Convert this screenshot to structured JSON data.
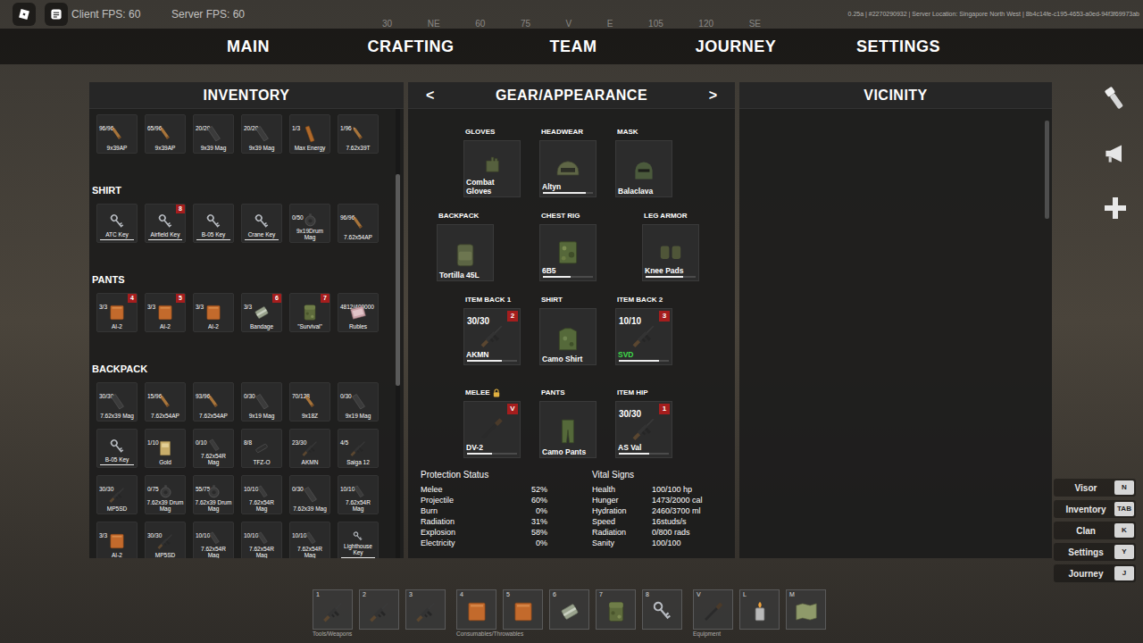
{
  "hud": {
    "client_fps": "Client FPS: 60",
    "server_fps": "Server FPS: 60",
    "server_info": "0.25a | #2270290932 | Server Location: Singapore North West | 8b4c14fe-c195-4653-a0ed-94f3f69973ab"
  },
  "compass": [
    "30",
    "NE",
    "60",
    "75",
    "V",
    "E",
    "105",
    "120",
    "SE"
  ],
  "nav": [
    "MAIN",
    "CRAFTING",
    "TEAM",
    "JOURNEY",
    "SETTINGS"
  ],
  "inventory": {
    "title": "INVENTORY",
    "sections": [
      {
        "items": [
          {
            "count": "96/96",
            "name": "9x39AP",
            "kind": "ammo"
          },
          {
            "count": "65/96",
            "name": "9x39AP",
            "kind": "ammo"
          },
          {
            "count": "20/20",
            "name": "9x39 Mag",
            "kind": "mag"
          },
          {
            "count": "20/20",
            "name": "9x39 Mag",
            "kind": "mag"
          },
          {
            "count": "1/3",
            "name": "Max Energy",
            "kind": "energy"
          },
          {
            "count": "1/96",
            "name": "7.62x39T",
            "kind": "ammo"
          }
        ]
      },
      {
        "label": "SHIRT",
        "items": [
          {
            "name": "ATC Key",
            "kind": "key",
            "level": 1
          },
          {
            "name": "Airfield Key",
            "kind": "key",
            "badge": "8",
            "level": 1
          },
          {
            "name": "B-05 Key",
            "kind": "key",
            "level": 1
          },
          {
            "name": "Crane Key",
            "kind": "key",
            "level": 1
          },
          {
            "count": "0/50",
            "name": "9x19Drum Mag",
            "kind": "drum"
          },
          {
            "count": "96/96",
            "name": "7.62x54AP",
            "kind": "ammo"
          }
        ]
      },
      {
        "label": "PANTS",
        "items": [
          {
            "count": "3/3",
            "name": "AI-2",
            "kind": "medkit",
            "badge": "4"
          },
          {
            "count": "3/3",
            "name": "AI-2",
            "kind": "medkit",
            "badge": "5"
          },
          {
            "count": "3/3",
            "name": "AI-2",
            "kind": "medkit"
          },
          {
            "count": "3/3",
            "name": "Bandage",
            "kind": "bandage",
            "badge": "6"
          },
          {
            "name": "\"Survival\"",
            "kind": "pouch",
            "badge": "7"
          },
          {
            "count": "4812/400000",
            "name": "Rubles",
            "kind": "money"
          }
        ]
      },
      {
        "label": "BACKPACK",
        "items": [
          {
            "count": "30/30",
            "name": "7.62x39 Mag",
            "kind": "mag"
          },
          {
            "count": "15/96",
            "name": "7.62x54AP",
            "kind": "ammo"
          },
          {
            "count": "93/96",
            "name": "7.62x54AP",
            "kind": "ammo"
          },
          {
            "count": "0/30",
            "name": "9x19 Mag",
            "kind": "mag"
          },
          {
            "count": "70/128",
            "name": "9x18Z",
            "kind": "ammo"
          },
          {
            "count": "0/30",
            "name": "9x19 Mag",
            "kind": "mag"
          },
          {
            "name": "B-05 Key",
            "kind": "key",
            "level": 1
          },
          {
            "count": "1/10",
            "name": "Gold",
            "kind": "gold"
          },
          {
            "count": "0/10",
            "name": "7.62x54R Mag",
            "kind": "mag"
          },
          {
            "count": "8/8",
            "name": "TFZ-O",
            "kind": "optic"
          },
          {
            "count": "23/30",
            "name": "AKMN",
            "kind": "weapon"
          },
          {
            "count": "4/5",
            "name": "Saiga 12",
            "kind": "weapon"
          },
          {
            "count": "30/30",
            "name": "MP5SD",
            "kind": "weapon"
          },
          {
            "count": "0/75",
            "name": "7.62x39 Drum Mag",
            "kind": "drum"
          },
          {
            "count": "55/75",
            "name": "7.62x39 Drum Mag",
            "kind": "drum"
          },
          {
            "count": "10/10",
            "name": "7.62x54R Mag",
            "kind": "mag"
          },
          {
            "count": "0/30",
            "name": "7.62x39 Mag",
            "kind": "mag"
          },
          {
            "count": "10/10",
            "name": "7.62x54R Mag",
            "kind": "mag"
          },
          {
            "count": "3/3",
            "name": "AI-2",
            "kind": "medkit"
          },
          {
            "count": "30/30",
            "name": "MP5SD",
            "kind": "weapon"
          },
          {
            "count": "10/10",
            "name": "7.62x54R Mag",
            "kind": "mag"
          },
          {
            "count": "10/10",
            "name": "7.62x54R Mag",
            "kind": "mag"
          },
          {
            "count": "10/10",
            "name": "7.62x54R Mag",
            "kind": "mag"
          },
          {
            "name": "Lighthouse Key",
            "kind": "key",
            "level": 1
          }
        ]
      }
    ]
  },
  "gear": {
    "title": "GEAR/APPEARANCE",
    "prev": "<",
    "next": ">",
    "rows": [
      [
        {
          "label": "GLOVES",
          "name": "Combat Gloves",
          "kind": "gloves",
          "color": "#ffffff",
          "locked": false
        },
        {
          "label": "HEADWEAR",
          "name": "Altyn",
          "kind": "helmet",
          "color": "#ffffff",
          "locked": false,
          "level": 0.85
        },
        {
          "label": "MASK",
          "name": "Balaclava",
          "kind": "mask",
          "color": "#ffffff",
          "locked": false
        }
      ],
      [
        {
          "label": "BACKPACK",
          "name": "Tortilla 45L",
          "kind": "backpack",
          "color": "#ffffff",
          "locked": false
        },
        {
          "label": "CHEST RIG",
          "name": "6B5",
          "kind": "rig",
          "color": "#ffffff",
          "locked": false,
          "level": 0.55
        },
        {
          "label": "LEG ARMOR",
          "name": "Knee Pads",
          "kind": "kneepad",
          "color": "#ffffff",
          "locked": false,
          "level": 0.75
        }
      ],
      [
        {
          "label": "ITEM BACK 1",
          "count": "30/30",
          "badge": "2",
          "name": "AKMN",
          "kind": "weapon",
          "color": "#ffffff",
          "locked": false,
          "level": 0.7
        },
        {
          "label": "SHIRT",
          "name": "Camo Shirt",
          "kind": "shirt",
          "color": "#ffffff",
          "locked": false
        },
        {
          "label": "ITEM BACK 2",
          "count": "10/10",
          "badge": "3",
          "name": "SVD",
          "kind": "weapon",
          "color": "#3fd94a",
          "locked": false,
          "level": 0.8
        }
      ],
      [
        {
          "label": "MELEE",
          "badge": "V",
          "name": "DV-2",
          "kind": "knife",
          "color": "#ffffff",
          "locked": true,
          "level": 0.5
        },
        {
          "label": "PANTS",
          "name": "Camo Pants",
          "kind": "pants",
          "color": "#ffffff",
          "locked": false
        },
        {
          "label": "ITEM HIP",
          "count": "30/30",
          "badge": "1",
          "name": "AS Val",
          "kind": "weapon",
          "color": "#ffffff",
          "locked": false,
          "level": 0.6
        }
      ]
    ]
  },
  "protection": {
    "title": "Protection Status",
    "rows": [
      {
        "label": "Melee",
        "value": "52%"
      },
      {
        "label": "Projectile",
        "value": "60%"
      },
      {
        "label": "Burn",
        "value": "0%"
      },
      {
        "label": "Radiation",
        "value": "31%"
      },
      {
        "label": "Explosion",
        "value": "58%"
      },
      {
        "label": "Electricity",
        "value": "0%"
      }
    ]
  },
  "vitals": {
    "title": "Vital Signs",
    "rows": [
      {
        "label": "Health",
        "value": "100/100 hp"
      },
      {
        "label": "Hunger",
        "value": "1473/2000 cal"
      },
      {
        "label": "Hydration",
        "value": "2460/3700 ml"
      },
      {
        "label": "Speed",
        "value": "16studs/s"
      },
      {
        "label": "Radiation",
        "value": "0/800 rads"
      },
      {
        "label": "Sanity",
        "value": "100/100"
      }
    ]
  },
  "vicinity": {
    "title": "VICINITY"
  },
  "keybinds": [
    {
      "label": "Visor",
      "key": "N"
    },
    {
      "label": "Inventory",
      "key": "TAB"
    },
    {
      "label": "Clan",
      "key": "K"
    },
    {
      "label": "Settings",
      "key": "Y"
    },
    {
      "label": "Journey",
      "key": "J"
    }
  ],
  "hotbar": {
    "groups": [
      {
        "label": "Tools/Weapons",
        "slots": [
          {
            "key": "1",
            "kind": "weapon"
          },
          {
            "key": "2",
            "kind": "weapon"
          },
          {
            "key": "3",
            "kind": "weapon"
          }
        ]
      },
      {
        "label": "Consumables/Throwables",
        "slots": [
          {
            "key": "4",
            "kind": "medkit"
          },
          {
            "key": "5",
            "kind": "medkit"
          },
          {
            "key": "6",
            "kind": "bandage"
          },
          {
            "key": "7",
            "kind": "pouch"
          },
          {
            "key": "8",
            "kind": "key"
          }
        ]
      },
      {
        "label": "Equipment",
        "slots": [
          {
            "key": "V",
            "kind": "knife"
          },
          {
            "key": "L",
            "kind": "lighter"
          },
          {
            "key": "M",
            "kind": "map"
          }
        ]
      }
    ]
  }
}
